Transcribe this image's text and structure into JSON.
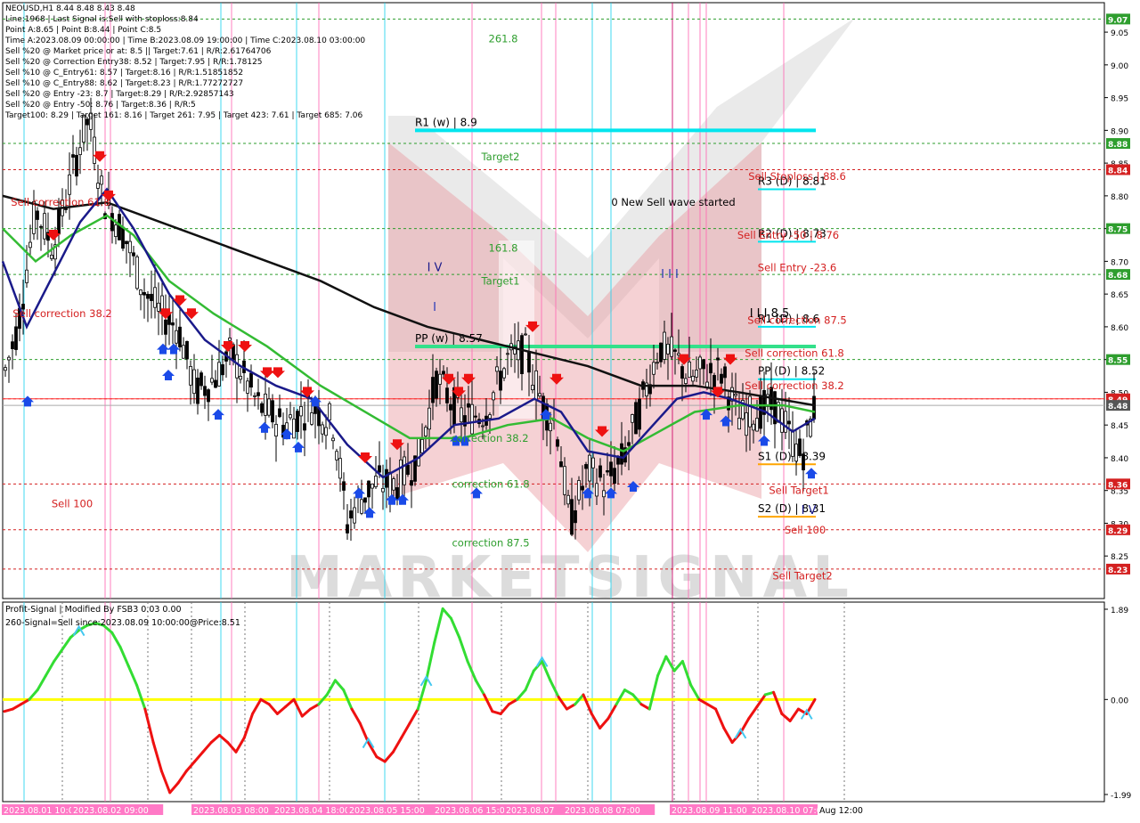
{
  "info_lines": [
    "NEOUSD,H1  8.44 8.48 8.43 8.48",
    "Line:1968 | Last Signal is:Sell with stoploss:8.84",
    "Point A:8.65 | Point B:8.44 | Point C:8.5",
    "Time A:2023.08.09 00:00:00 | Time B:2023.08.09 19:00:00 | Time C:2023.08.10 03:00:00",
    "Sell %20 @ Market price or at: 8.5 || Target:7.61 | R/R:2.61764706",
    "Sell %20 @ Correction Entry38: 8.52 | Target:7.95 | R/R:1.78125",
    "Sell %10 @ C_Entry61: 8.57 | Target:8.16 | R/R:1.51851852",
    "Sell %10 @ C_Entry88: 8.62 | Target:8.23 | R/R:1.77272727",
    "Sell %20 @ Entry -23: 8.7 | Target:8.29 | R/R:2.92857143",
    "Sell %20 @ Entry -50: 8.76 | Target:8.36 | R/R:5",
    "Target100: 8.29 | Target 161: 8.16 | Target 261: 7.95 | Target 423: 7.61 | Target 685: 7.06"
  ],
  "chart_data": [
    {
      "type": "candlestick",
      "symbol": "NEOUSD,H1",
      "ohlc_last": {
        "open": 8.44,
        "high": 8.48,
        "low": 8.43,
        "close": 8.48
      },
      "ylim": [
        8.185,
        9.095
      ],
      "y_ticks": [
        9.05,
        9.0,
        8.95,
        8.9,
        8.85,
        8.8,
        8.75,
        8.7,
        8.65,
        8.6,
        8.55,
        8.5,
        8.45,
        8.4,
        8.35,
        8.3,
        8.25
      ],
      "y_tick_labels": [
        "9.05",
        "9.00",
        "8.95",
        "8.90",
        "8.85",
        "8.80",
        "8.75",
        "8.70",
        "8.65",
        "8.60",
        "8.55",
        "8.50",
        "8.45",
        "8.40",
        "8.35",
        "8.30",
        "8.25"
      ],
      "highlighted_prices": [
        {
          "label": "9.07",
          "value": 9.07,
          "color": "#2e9e2e"
        },
        {
          "label": "8.88",
          "value": 8.88,
          "color": "#2e9e2e"
        },
        {
          "label": "8.84",
          "value": 8.84,
          "color": "#d42020"
        },
        {
          "label": "8.75",
          "value": 8.75,
          "color": "#2e9e2e"
        },
        {
          "label": "8.68",
          "value": 8.68,
          "color": "#2e9e2e"
        },
        {
          "label": "8.55",
          "value": 8.55,
          "color": "#2e9e2e"
        },
        {
          "label": "8.49",
          "value": 8.49,
          "color": "#d42020"
        },
        {
          "label": "8.48",
          "value": 8.48,
          "color": "#555555"
        },
        {
          "label": "8.36",
          "value": 8.36,
          "color": "#d42020"
        },
        {
          "label": "8.29",
          "value": 8.29,
          "color": "#d42020"
        },
        {
          "label": "8.23",
          "value": 8.23,
          "color": "#d42020"
        }
      ],
      "levels": [
        {
          "label": "R1 (w) | 8.9",
          "value": 8.9,
          "color": "#00e5ee"
        },
        {
          "label": "PP (w) | 8.57",
          "value": 8.57,
          "color": "#33e08a"
        },
        {
          "label": "R3 (D) | 8.81",
          "value": 8.81,
          "color": "#00e5ee"
        },
        {
          "label": "R2 (D) | 8.73",
          "value": 8.73,
          "color": "#00e5ee"
        },
        {
          "label": "R1 (D) | 8.6",
          "value": 8.6,
          "color": "#00e5ee"
        },
        {
          "label": "PP (D) | 8.52",
          "value": 8.52,
          "color": "#00e5ee"
        },
        {
          "label": "S1 (D) | 8.39",
          "value": 8.39,
          "color": "#ffa500"
        },
        {
          "label": "S2 (D) | 8.31",
          "value": 8.31,
          "color": "#ffa500"
        }
      ],
      "annotations": [
        {
          "text": "261.8",
          "value": 9.04,
          "color": "#2e9e2e"
        },
        {
          "text": "Target2",
          "value": 8.86,
          "color": "#2e9e2e"
        },
        {
          "text": "161.8",
          "value": 8.72,
          "color": "#2e9e2e"
        },
        {
          "text": "Target1",
          "value": 8.67,
          "color": "#2e9e2e"
        },
        {
          "text": "correction 38.2",
          "value": 8.43,
          "color": "#2e9e2e"
        },
        {
          "text": "correction 61.8",
          "value": 8.36,
          "color": "#2e9e2e"
        },
        {
          "text": "correction 87.5",
          "value": 8.27,
          "color": "#2e9e2e"
        },
        {
          "text": "0 New Sell wave started",
          "value": 8.79,
          "color": "#000000"
        },
        {
          "text": "Sell Stoploss | 88.6",
          "value": 8.83,
          "color": "#d42020"
        },
        {
          "text": "Sell Entry -50 | 8.76",
          "value": 8.74,
          "color": "#d42020"
        },
        {
          "text": "Sell Entry -23.6",
          "value": 8.69,
          "color": "#d42020"
        },
        {
          "text": "Sell correction 87.5",
          "value": 8.61,
          "color": "#d42020"
        },
        {
          "text": "Sell correction 61.8",
          "value": 8.56,
          "color": "#d42020"
        },
        {
          "text": "Sell correction 38.2",
          "value": 8.51,
          "color": "#d42020"
        },
        {
          "text": "Sell Target1",
          "value": 8.35,
          "color": "#d42020"
        },
        {
          "text": "Sell 100",
          "value": 8.29,
          "color": "#d42020"
        },
        {
          "text": "Sell Target2",
          "value": 8.22,
          "color": "#d42020"
        },
        {
          "text": "Sell correction 61.8",
          "value": 8.79,
          "color": "#d42020"
        },
        {
          "text": "Sell correction 38.2",
          "value": 8.62,
          "color": "#d42020"
        },
        {
          "text": "Sell 100",
          "value": 8.33,
          "color": "#d42020"
        },
        {
          "text": "I V",
          "value": 8.69,
          "color": "#1a1a8a"
        },
        {
          "text": "I",
          "value": 8.63,
          "color": "#2a3ab8"
        },
        {
          "text": "I I I",
          "value": 8.68,
          "color": "#2a3ab8"
        },
        {
          "text": "I I I 8.5",
          "value": 8.62,
          "color": "#000000"
        },
        {
          "text": "I V",
          "value": 8.32,
          "color": "#1a1a8a"
        }
      ],
      "x_tick_labels": [
        "2023.08.01 10:00",
        "2023.08.02 09:00",
        "2023.08.03 08:00",
        "2023.08.04 18:00",
        "2023.08.05 15:00",
        "2023.08.06 15:00",
        "2023.08.07",
        "2023.08.08 07:00",
        "2023.08.09 11:00",
        "2023.08.10 07:00",
        "Aug 12:00"
      ],
      "watermark": "MARKETSIGNAL"
    },
    {
      "type": "line",
      "title": "Profit-Signal | Modified By FSB3 0.03 0.00",
      "subtitle": "260-Signal=Sell since:2023.08.09 10:00:00@Price:8.51",
      "ylim": [
        -1.99,
        1.89
      ],
      "y_ticks": [
        1.89,
        0.0,
        -1.99
      ],
      "y_tick_labels": [
        "1.89",
        "0.00",
        "-1.99"
      ],
      "zero_line_color": "#ffff00",
      "series": [
        {
          "color_positive": "#33dd33",
          "color_negative": "#ee1111",
          "values": [
            -0.25,
            -0.2,
            -0.1,
            0.0,
            0.2,
            0.5,
            0.8,
            1.05,
            1.3,
            1.45,
            1.55,
            1.6,
            1.55,
            1.4,
            1.1,
            0.7,
            0.3,
            -0.2,
            -0.9,
            -1.5,
            -1.95,
            -1.75,
            -1.5,
            -1.3,
            -1.1,
            -0.9,
            -0.75,
            -0.9,
            -1.1,
            -0.8,
            -0.3,
            0.0,
            -0.1,
            -0.3,
            -0.15,
            0.0,
            -0.35,
            -0.2,
            -0.1,
            0.1,
            0.4,
            0.2,
            -0.2,
            -0.5,
            -0.9,
            -1.2,
            -1.3,
            -1.1,
            -0.8,
            -0.5,
            -0.2,
            0.4,
            1.2,
            1.9,
            1.7,
            1.3,
            0.8,
            0.4,
            0.1,
            -0.25,
            -0.3,
            -0.1,
            0.0,
            0.2,
            0.6,
            0.8,
            0.4,
            0.05,
            -0.2,
            -0.1,
            0.1,
            -0.3,
            -0.6,
            -0.4,
            -0.1,
            0.2,
            0.1,
            -0.1,
            -0.2,
            0.5,
            0.9,
            0.6,
            0.8,
            0.3,
            0.0,
            -0.1,
            -0.2,
            -0.6,
            -0.9,
            -0.7,
            -0.4,
            -0.15,
            0.1,
            0.15,
            -0.3,
            -0.45,
            -0.2,
            -0.3,
            0.0
          ]
        }
      ],
      "signal_points": [
        9,
        44,
        51,
        65,
        89,
        97,
        101,
        103
      ]
    }
  ],
  "sub_chart_labels": {
    "title": "Profit-Signal | Modified By FSB3 0.03 0.00",
    "subtitle": "260-Signal=Sell since:2023.08.09 10:00:00@Price:8.51"
  }
}
